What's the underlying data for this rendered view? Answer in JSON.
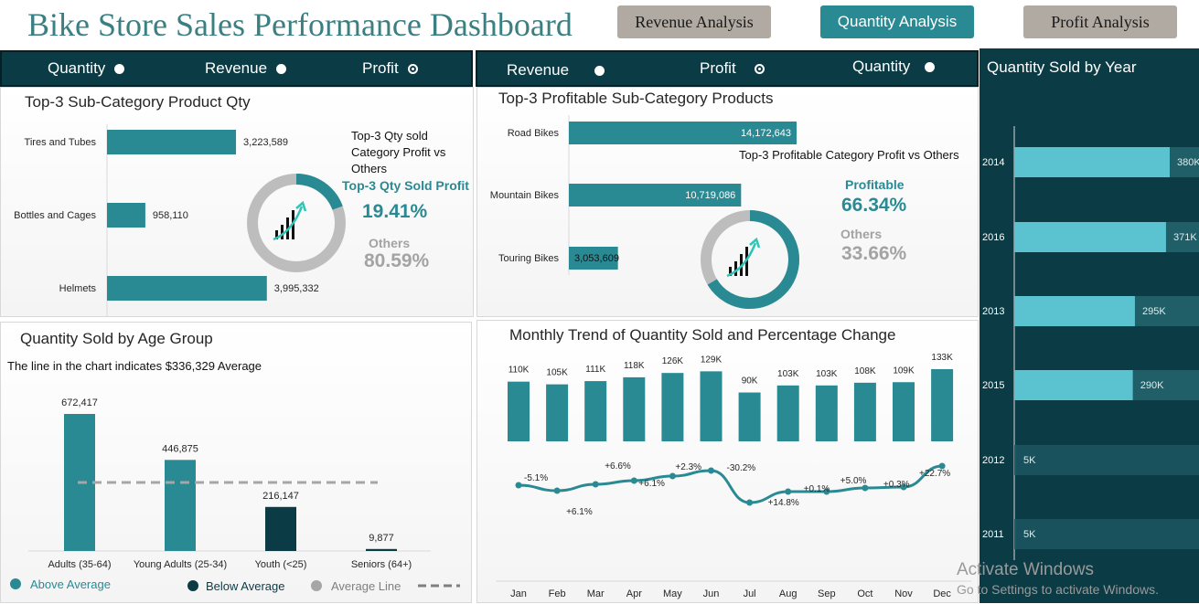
{
  "header": {
    "title": "Bike Store Sales Performance Dashboard",
    "nav": {
      "revenue": "Revenue Analysis",
      "quantity": "Quantity Analysis",
      "profit": "Profit Analysis"
    }
  },
  "slicer_left": {
    "options": [
      "Quantity",
      "Revenue",
      "Profit"
    ],
    "selected": "Profit"
  },
  "slicer_mid": {
    "options": [
      "Revenue",
      "Profit",
      "Quantity"
    ],
    "selected": "Profit"
  },
  "colors": {
    "teal": "#2a8a93",
    "dark_teal": "#0b3b45",
    "light_teal": "#5bc2cf",
    "grey": "#bdbdbd"
  },
  "panel_topleft": {
    "title": "Top-3 Sub-Category Product Qty",
    "donut_caption": "Top-3 Qty sold Category Profit vs Others",
    "donut_main_label": "Top-3 Qty Sold Profit",
    "donut_main_value": "19.41%",
    "donut_other_label": "Others",
    "donut_other_value": "80.59%",
    "icon": "growth-chart-icon"
  },
  "panel_topmid": {
    "title": "Top-3 Profitable Sub-Category Products",
    "donut_caption": "Top-3 Profitable Category Profit vs Others",
    "donut_main_label": "Profitable",
    "donut_main_value": "66.34%",
    "donut_other_label": "Others",
    "donut_other_value": "33.66%",
    "icon": "growth-chart-icon"
  },
  "panel_age": {
    "title": "Quantity Sold by Age Group",
    "subtitle": "The line in the chart indicates $336,329 Average",
    "legend": [
      "Above Average",
      "Below Average",
      "Average Line"
    ]
  },
  "panel_monthly": {
    "title": "Monthly Trend of Quantity Sold and Percentage Change"
  },
  "panel_year": {
    "title": "Quantity Sold by Year"
  },
  "watermark": {
    "line1": "Activate Windows",
    "line2": "Go to Settings to activate Windows."
  },
  "chart_data": [
    {
      "type": "bar",
      "orientation": "horizontal",
      "categories": [
        "Tires and Tubes",
        "Bottles and Cages",
        "Helmets"
      ],
      "values": [
        3223589,
        958110,
        3995332
      ],
      "labels": [
        "3,223,589",
        "958,110",
        "3,995,332"
      ]
    },
    {
      "type": "pie",
      "variant": "donut",
      "slices": [
        {
          "name": "Top-3 Qty Sold Profit",
          "value": 19.41
        },
        {
          "name": "Others",
          "value": 80.59
        }
      ]
    },
    {
      "type": "bar",
      "orientation": "horizontal",
      "categories": [
        "Road Bikes",
        "Mountain Bikes",
        "Touring Bikes"
      ],
      "values": [
        14172643,
        10719086,
        3053609
      ],
      "labels": [
        "14,172,643",
        "10,719,086",
        "3,053,609"
      ]
    },
    {
      "type": "pie",
      "variant": "donut",
      "slices": [
        {
          "name": "Profitable",
          "value": 66.34
        },
        {
          "name": "Others",
          "value": 33.66
        }
      ]
    },
    {
      "type": "bar",
      "categories": [
        "Adults (35-64)",
        "Young Adults (25-34)",
        "Youth (<25)",
        "Seniors (64+)"
      ],
      "values": [
        672417,
        446875,
        216147,
        9877
      ],
      "labels": [
        "672,417",
        "446,875",
        "216,147",
        "9,877"
      ],
      "above_average": [
        true,
        true,
        false,
        false
      ],
      "average": 336329
    },
    {
      "type": "bar",
      "categories": [
        "Jan",
        "Feb",
        "Mar",
        "Apr",
        "May",
        "Jun",
        "Jul",
        "Aug",
        "Sep",
        "Oct",
        "Nov",
        "Dec"
      ],
      "values": [
        110,
        105,
        111,
        118,
        126,
        129,
        90,
        103,
        103,
        108,
        109,
        133
      ],
      "labels": [
        "110K",
        "105K",
        "111K",
        "118K",
        "126K",
        "129K",
        "90K",
        "103K",
        "103K",
        "108K",
        "109K",
        "133K"
      ],
      "unit": "K"
    },
    {
      "type": "line",
      "categories": [
        "Jan",
        "Feb",
        "Mar",
        "Apr",
        "May",
        "Jun",
        "Jul",
        "Aug",
        "Sep",
        "Oct",
        "Nov",
        "Dec"
      ],
      "values": [
        -5.1,
        6.1,
        6.6,
        6.1,
        2.3,
        -30.2,
        14.8,
        0.1,
        5.0,
        0.3,
        22.7,
        null
      ],
      "labels": [
        "-5.1%",
        "+6.1%",
        "+6.6%",
        "+6.1%",
        "+2.3%",
        "-30.2%",
        "+14.8%",
        "+0.1%",
        "+5.0%",
        "+0.3%",
        "+22.7%"
      ]
    },
    {
      "type": "bar",
      "orientation": "horizontal",
      "categories": [
        "2014",
        "2016",
        "2013",
        "2015",
        "2012",
        "2011"
      ],
      "values": [
        380,
        371,
        295,
        290,
        5,
        5
      ],
      "labels": [
        "380K",
        "371K",
        "295K",
        "290K",
        "5K",
        "5K"
      ],
      "unit": "K"
    }
  ]
}
